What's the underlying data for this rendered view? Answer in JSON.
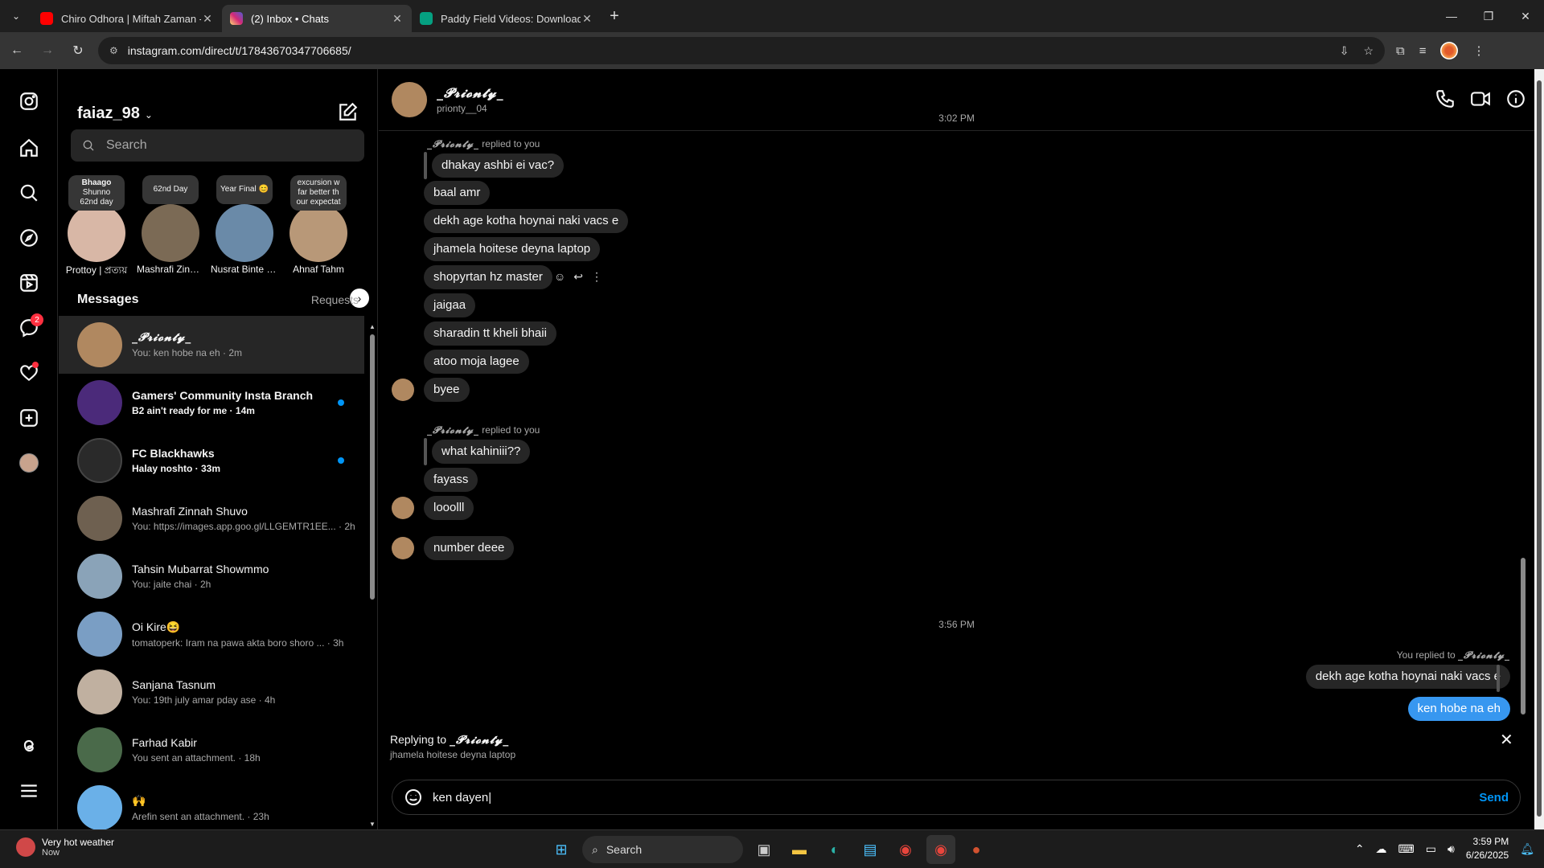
{
  "browser": {
    "tabs": [
      {
        "title": "Chiro Odhora | Miftah Zaman -",
        "color": "#ff0000"
      },
      {
        "title": "(2) Inbox • Chats",
        "color": "#e1306c"
      },
      {
        "title": "Paddy Field Videos: Download",
        "color": "#05a081"
      }
    ],
    "url": "instagram.com/direct/t/17843670347706685/"
  },
  "rail": {
    "messages_badge": "2"
  },
  "sidebar": {
    "username": "faiaz_98",
    "search_placeholder": "Search",
    "notes": [
      {
        "title": "Bhaago",
        "line2": "Shunno",
        "line3": "62nd day",
        "name": "Prottoy | প্রত্যয়",
        "color": "#d8b7a6"
      },
      {
        "title": "62nd Day",
        "line2": "",
        "line3": "",
        "name": "Mashrafi Zinnah...",
        "color": "#7b6a55"
      },
      {
        "title": "Year Final 😊",
        "line2": "",
        "line3": "",
        "name": "Nusrat Binte Ekr...",
        "color": "#6a8aa8"
      },
      {
        "title": "excursion w",
        "line2": "far better th",
        "line3": "our expectat",
        "name": "Ahnaf Tahm",
        "color": "#b89878"
      }
    ],
    "messages_label": "Messages",
    "requests_label": "Requests",
    "conversations": [
      {
        "name": "_𝓟𝓻𝓲𝓸𝓷𝓽𝔂_",
        "preview": "You: ken hobe na eh · 2m",
        "color": "#b08860",
        "selected": true
      },
      {
        "name": "Gamers' Community Insta Branch",
        "preview": "B2 ain't ready for me · 14m",
        "color": "#4b2a7a",
        "unread": true
      },
      {
        "name": "FC Blackhawks",
        "preview": "Halay noshto · 33m",
        "color": "#2a2a2a",
        "unread": true
      },
      {
        "name": "Mashrafi Zinnah Shuvo",
        "preview": "You: https://images.app.goo.gl/LLGEMTR1EE... · 2h",
        "color": "#6e6050"
      },
      {
        "name": "Tahsin Mubarrat Showmmo",
        "preview": "You: jaite chai · 2h",
        "color": "#8aa3b8"
      },
      {
        "name": "Oi Kire😆",
        "preview": "tomatoperk: Iram na pawa akta boro shoro ... · 3h",
        "color": "#7a9ec4"
      },
      {
        "name": "Sanjana Tasnum",
        "preview": "You: 19th july amar pday ase · 4h",
        "color": "#c0b0a0"
      },
      {
        "name": "Farhad Kabir",
        "preview": "You sent an attachment. · 18h",
        "color": "#4a6a4a"
      },
      {
        "name": "🙌",
        "preview": "Arefin sent an attachment. · 23h",
        "color": "#6ab0e8"
      }
    ]
  },
  "chat": {
    "name": "_𝓟𝓻𝓲𝓸𝓷𝓽𝔂_",
    "username": "prionty__04",
    "ts1": "3:02 PM",
    "ts2": "3:56 PM",
    "replied_label": "replied to you",
    "replied_name": "_𝓟𝓻𝓲𝓸𝓷𝓽𝔂_",
    "you_replied_label": "You replied to",
    "quote1": "dhakay ashbi ei vac?",
    "quote2": "what kahiniii??",
    "my_quote": "dekh age kotha hoynai naki vacs e",
    "my_message": "ken hobe na eh",
    "messages1": [
      "baal amr",
      "dekh age kotha hoynai naki vacs e",
      "jhamela hoitese deyna laptop",
      "shopyrtan hz master",
      "jaigaa",
      "sharadin tt kheli bhaii",
      "atoo moja lagee",
      "byee"
    ],
    "messages2": [
      "fayass",
      "looolll"
    ],
    "message3": "number deee",
    "reply_label": "Replying to",
    "reply_text": "jhamela hoitese deyna laptop",
    "composer_text": "ken dayen",
    "send_label": "Send"
  },
  "taskbar": {
    "weather_title": "Very hot weather",
    "weather_sub": "Now",
    "search_label": "Search",
    "time": "3:59 PM",
    "date": "6/26/2025"
  }
}
